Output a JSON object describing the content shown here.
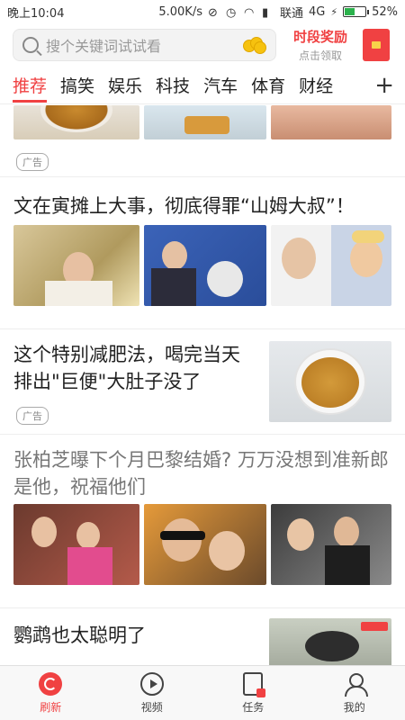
{
  "status_bar": {
    "time": "晚上10:04",
    "net_speed": "5.00K/s",
    "carrier": "联通",
    "network": "4G",
    "battery": "52%",
    "battery_level": 0.52
  },
  "header": {
    "search_placeholder": "搜个关键词试试看",
    "reward_title": "时段奖励",
    "reward_sub": "点击领取"
  },
  "tabs": [
    "推荐",
    "搞笑",
    "娱乐",
    "科技",
    "汽车",
    "体育",
    "财经"
  ],
  "feed": {
    "top_ad_tag": "广告",
    "items": [
      {
        "title": "文在寅摊上大事，彻底得罪“山姆大叔”！"
      },
      {
        "title": "这个特别减肥法，喝完当天排出\"巨便\"大肚子没了",
        "tag": "广告"
      },
      {
        "title": "张柏芝曝下个月巴黎结婚? 万万没想到准新郎是他，祝福他们"
      },
      {
        "title": "鹦鹉也太聪明了"
      }
    ]
  },
  "bottom_nav": [
    "刷新",
    "视频",
    "任务",
    "我的"
  ],
  "colors": {
    "accent": "#f04142"
  }
}
